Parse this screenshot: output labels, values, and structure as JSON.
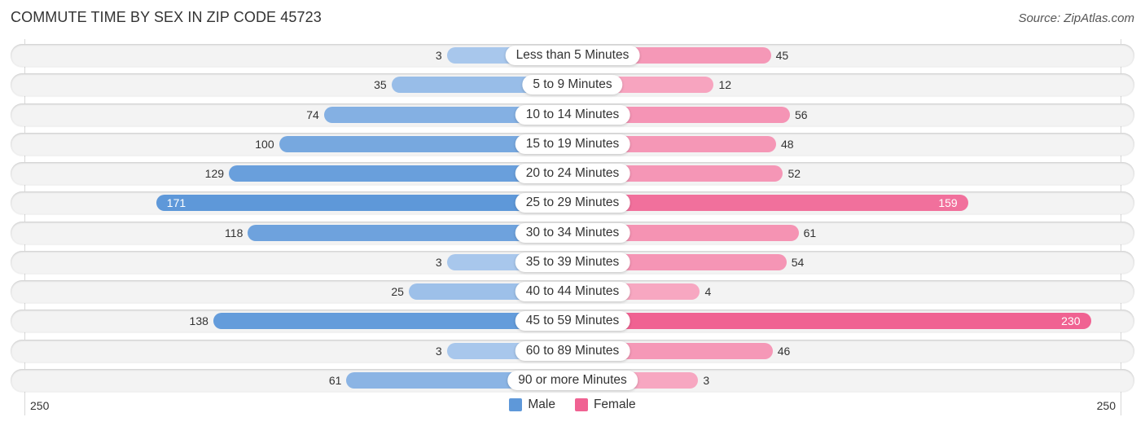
{
  "header": {
    "title": "COMMUTE TIME BY SEX IN ZIP CODE 45723",
    "source": "Source: ZipAtlas.com"
  },
  "colors": {
    "male_dark": "#5e98d9",
    "male_light": "#a9c8ec",
    "female_dark": "#f06292",
    "female_light": "#f7a8c2"
  },
  "chart_data": {
    "type": "bar",
    "orientation": "horizontal-diverging",
    "title": "COMMUTE TIME BY SEX IN ZIP CODE 45723",
    "categories": [
      "Less than 5 Minutes",
      "5 to 9 Minutes",
      "10 to 14 Minutes",
      "15 to 19 Minutes",
      "20 to 24 Minutes",
      "25 to 29 Minutes",
      "30 to 34 Minutes",
      "35 to 39 Minutes",
      "40 to 44 Minutes",
      "45 to 59 Minutes",
      "60 to 89 Minutes",
      "90 or more Minutes"
    ],
    "series": [
      {
        "name": "Male",
        "side": "left",
        "values": [
          3,
          35,
          74,
          100,
          129,
          171,
          118,
          3,
          25,
          138,
          3,
          61
        ]
      },
      {
        "name": "Female",
        "side": "right",
        "values": [
          45,
          12,
          56,
          48,
          52,
          159,
          61,
          54,
          4,
          230,
          46,
          3
        ]
      }
    ],
    "axis": {
      "left_tick": "250",
      "right_tick": "250",
      "range": [
        0,
        250
      ]
    },
    "legend": {
      "position": "bottom-center",
      "entries": [
        "Male",
        "Female"
      ]
    },
    "grid": false
  }
}
